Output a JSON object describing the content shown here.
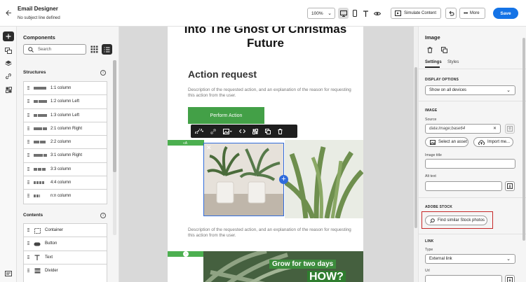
{
  "header": {
    "title": "Email Designer",
    "subtitle": "No subject line defined",
    "zoom": "100%",
    "simulate_label": "Simulate Content",
    "more_label": "More",
    "save_label": "Save"
  },
  "components": {
    "title": "Components",
    "search_placeholder": "Search",
    "structures_title": "Structures",
    "structures": [
      {
        "label": "1:1 column",
        "blocks": [
          18
        ]
      },
      {
        "label": "1:2 column Left",
        "blocks": [
          6,
          12
        ]
      },
      {
        "label": "1:3 column Left",
        "blocks": [
          5,
          13
        ]
      },
      {
        "label": "2:1 column Right",
        "blocks": [
          12,
          6
        ]
      },
      {
        "label": "2:2 column",
        "blocks": [
          8,
          8
        ]
      },
      {
        "label": "3:1 column Right",
        "blocks": [
          13,
          5
        ]
      },
      {
        "label": "3:3 column",
        "blocks": [
          5,
          5,
          5
        ]
      },
      {
        "label": "4:4 column",
        "blocks": [
          3,
          3,
          3,
          3
        ]
      },
      {
        "label": "n:n column",
        "blocks": [
          3,
          3,
          1
        ]
      }
    ],
    "contents_title": "Contents",
    "contents": [
      {
        "label": "Container",
        "icon": "container-icon"
      },
      {
        "label": "Button",
        "icon": "button-icon"
      },
      {
        "label": "Text",
        "icon": "text-icon"
      },
      {
        "label": "Divider",
        "icon": "divider-icon"
      }
    ]
  },
  "canvas": {
    "hero_title": "Into The Ghost Of Christmas Future",
    "action_title": "Action request",
    "description": "Description of the requested action, and an explanation of the reason for requesting this action from the user.",
    "cta_label": "Perform Action",
    "banner_line1": "Grow for two days",
    "banner_line2": "HOW?"
  },
  "properties": {
    "title": "Image",
    "tabs": [
      "Settings",
      "Styles"
    ],
    "display_options_title": "DISPLAY OPTIONS",
    "display_value": "Show on all devices",
    "image_title": "IMAGE",
    "source_label": "Source",
    "source_value": "data:image;base64",
    "select_asset_label": "Select an asset",
    "import_label": "Import me...",
    "image_title_label": "Image title",
    "alt_text_label": "Alt text",
    "adobe_stock_title": "ADOBE STOCK",
    "find_stock_label": "Find similar Stock photos",
    "link_title": "LINK",
    "type_label": "Type",
    "type_value": "External link",
    "url_label": "Url"
  },
  "colors": {
    "accent": "#1473e6",
    "cta_green": "#43a047",
    "selection_blue": "#2f6bdc",
    "highlight_red": "#c62828"
  }
}
